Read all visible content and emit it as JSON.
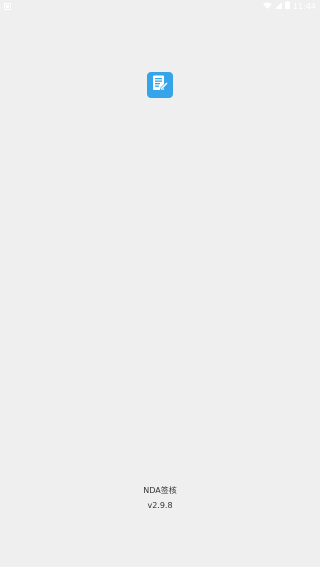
{
  "status_bar": {
    "time": "11:44",
    "icons": [
      "notification-icon",
      "wifi-icon",
      "signal-icon",
      "battery-icon"
    ],
    "text_color": "#ffffff"
  },
  "splash": {
    "app_icon": "document-edit-icon",
    "icon_color": "#35a4e9",
    "app_name": "NDA签核",
    "version": "v2.9.8",
    "background": "#efefef"
  }
}
